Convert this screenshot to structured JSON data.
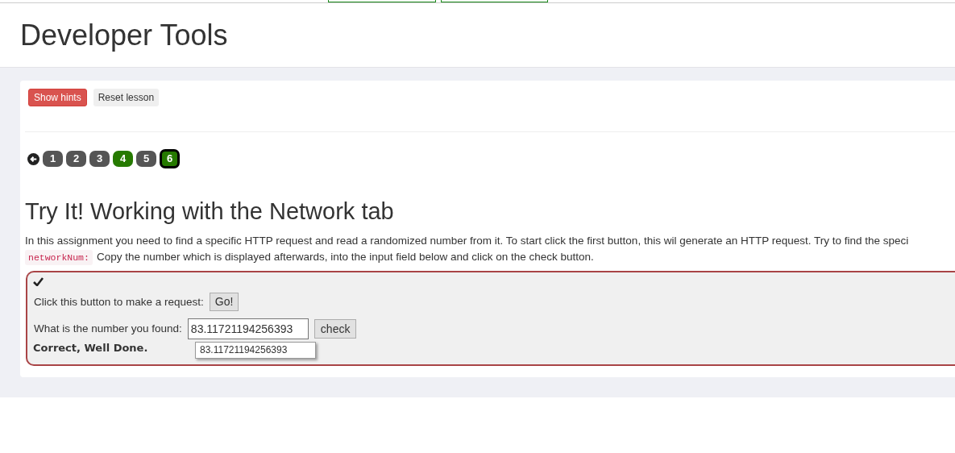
{
  "header": {
    "title": "Developer Tools"
  },
  "toolbar": {
    "buttons": [
      {
        "label": "Show hints",
        "kind": "danger"
      },
      {
        "label": "Reset lesson",
        "kind": "default"
      }
    ]
  },
  "pages": [
    {
      "label": "1",
      "completed": false,
      "selected": false
    },
    {
      "label": "2",
      "completed": false,
      "selected": false
    },
    {
      "label": "3",
      "completed": false,
      "selected": false
    },
    {
      "label": "4",
      "completed": true,
      "selected": false
    },
    {
      "label": "5",
      "completed": false,
      "selected": false
    },
    {
      "label": "6",
      "completed": true,
      "selected": true
    }
  ],
  "lesson": {
    "title": "Try It! Working with the Network tab",
    "intro_line": "In this assignment you need to find a specific HTTP request and read a randomized number from it. To start click the first button, this wil generate an HTTP request. Try to find the speci",
    "code": "networkNum:",
    "intro_rest": "Copy the number which is displayed afterwards, into the input field below and click on the check button."
  },
  "assignment": {
    "solved": true,
    "request_label": "Click this button to make a request:",
    "go_button": "Go!",
    "number_label": "What is the number you found:",
    "number_value": "83.11721194256393",
    "check_button": "check",
    "suggestion": "83.11721194256393",
    "feedback": "Correct, Well Done."
  }
}
